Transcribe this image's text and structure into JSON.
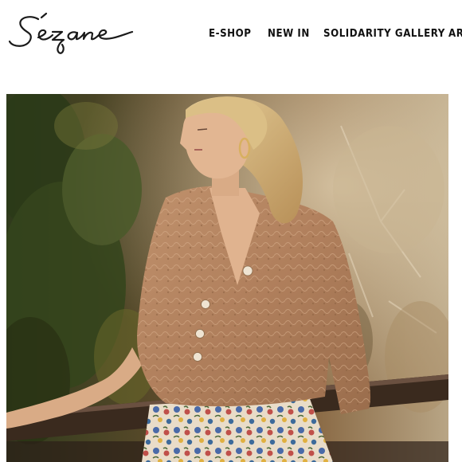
{
  "brand": {
    "logo_text": "Sézane"
  },
  "nav": {
    "items": [
      {
        "label": "E-SHOP"
      },
      {
        "label": "NEW IN"
      },
      {
        "label": "SOLIDARITY GALLERY"
      },
      {
        "label": "AR"
      }
    ]
  },
  "colors": {
    "background": "#ffffff",
    "nav_text": "#111111",
    "logo_ink": "#1a1a1a",
    "sweater": "#b98a67",
    "foliage": "#3a4a22",
    "railing": "#3a2a1e"
  },
  "hero": {
    "icon": "model-photo-image"
  }
}
